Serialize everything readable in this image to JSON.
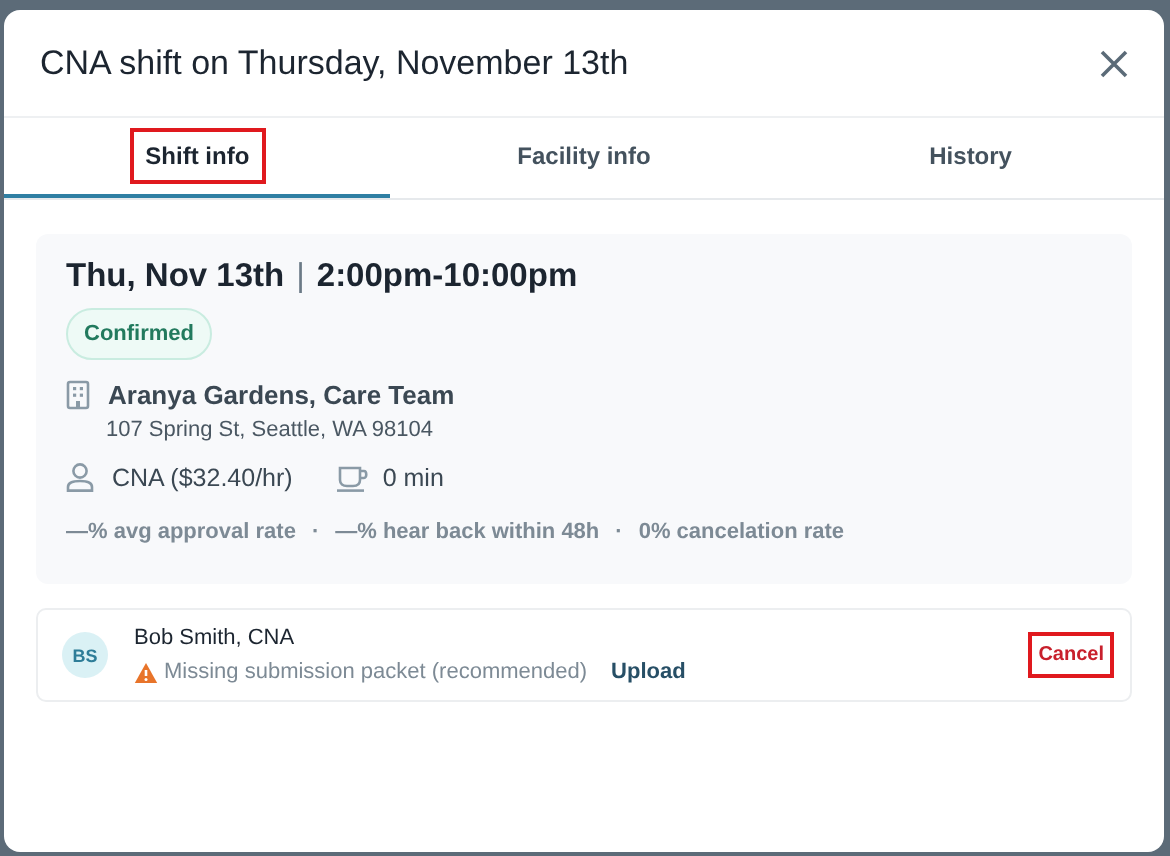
{
  "dialog": {
    "title": "CNA shift on Thursday, November 13th"
  },
  "tabs": [
    {
      "label": "Shift info",
      "selected": true,
      "highlighted": true
    },
    {
      "label": "Facility info",
      "selected": false,
      "highlighted": false
    },
    {
      "label": "History",
      "selected": false,
      "highlighted": false
    }
  ],
  "shift": {
    "date": "Thu, Nov 13th",
    "separator": "|",
    "time": "2:00pm-10:00pm",
    "status": "Confirmed",
    "facility": "Aranya Gardens, Care Team",
    "address": "107 Spring St, Seattle, WA 98104",
    "role": "CNA ($32.40/hr)",
    "break": "0 min",
    "stats": [
      "—% avg approval rate",
      "—% hear back within 48h",
      "0% cancelation rate"
    ],
    "stats_separator": "·"
  },
  "worker": {
    "initials": "BS",
    "name": "Bob Smith, CNA",
    "warning": "Missing submission packet (recommended)",
    "action": "Upload",
    "cancel": {
      "label": "Cancel",
      "highlighted": true
    }
  }
}
